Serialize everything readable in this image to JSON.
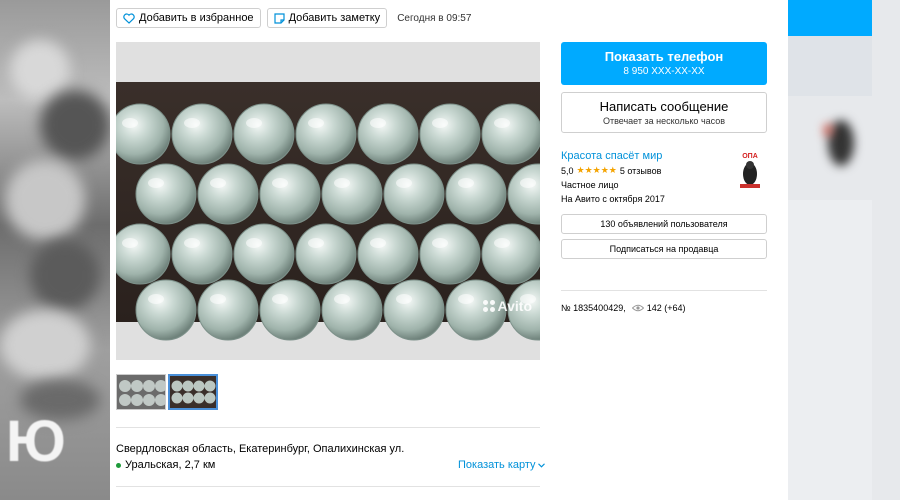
{
  "toolbar": {
    "favorite_label": "Добавить в избранное",
    "note_label": "Добавить заметку",
    "date_text": "Сегодня в 09:57"
  },
  "gallery": {
    "watermark_text": "Avito",
    "thumbnail_count": 2,
    "active_thumbnail": 2
  },
  "location": {
    "address": "Свердловская область, Екатеринбург, Опалихинская ул.",
    "metro": "Уральская, 2,7 км",
    "show_map_label": "Показать карту",
    "metro_color": "#1e9a3a"
  },
  "contact": {
    "phone_button_label": "Показать телефон",
    "phone_masked": "8 950 XXX-XX-XX",
    "message_button_label": "Написать сообщение",
    "message_button_sub": "Отвечает за несколько часов",
    "accent_color": "#00aaff"
  },
  "seller": {
    "name": "Красота спасёт мир",
    "rating": "5,0",
    "stars": "★★★★★",
    "reviews": "5 отзывов",
    "type": "Частное лицо",
    "since": "На Авито с октября 2017",
    "avatar_text": "ОПА"
  },
  "seller_actions": {
    "listings_label": "130 объявлений пользователя",
    "subscribe_label": "Подписаться на продавца"
  },
  "listing_meta": {
    "number": "№ 1835400429,",
    "views": "142 (+64)"
  }
}
